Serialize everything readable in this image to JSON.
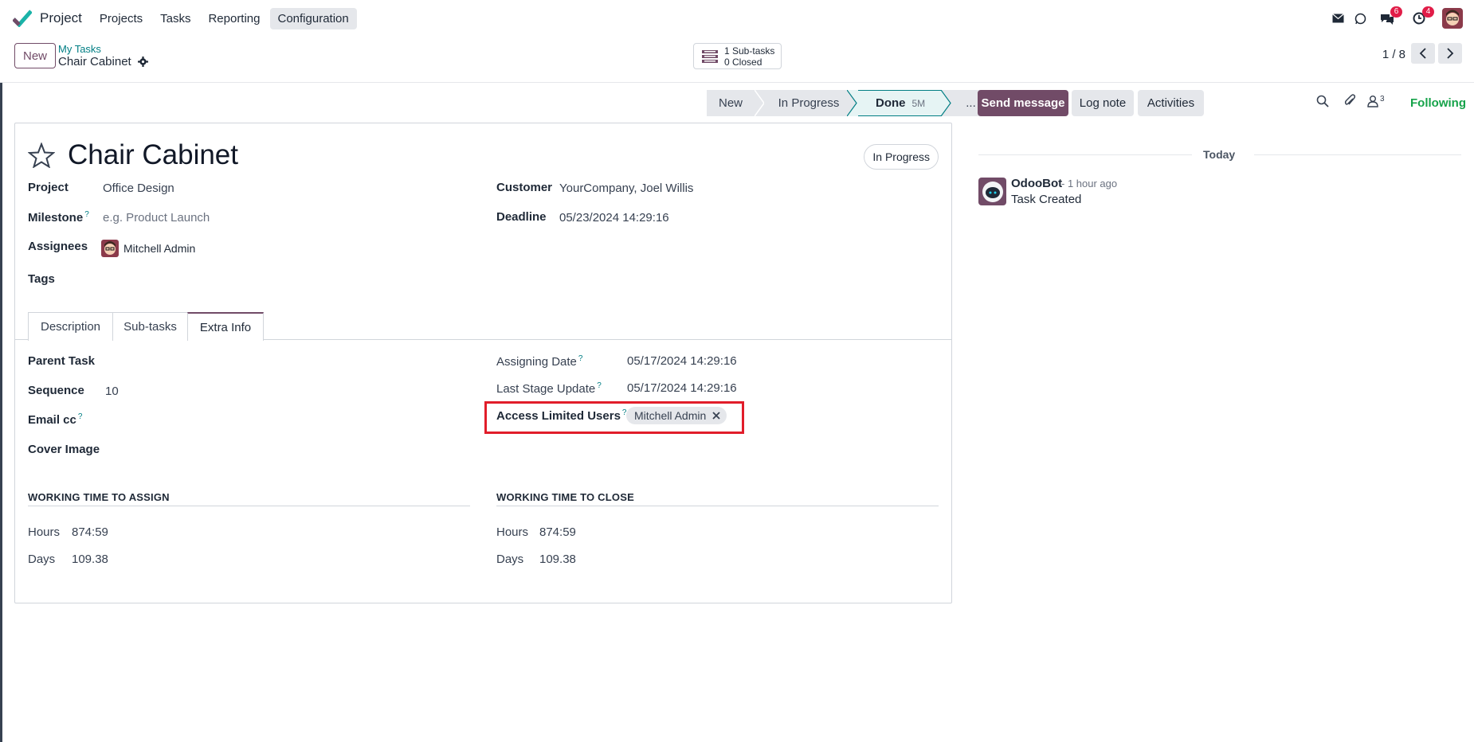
{
  "topnav": {
    "app_name": "Project",
    "menu": [
      "Projects",
      "Tasks",
      "Reporting",
      "Configuration"
    ],
    "active_menu": "Configuration",
    "badges": {
      "chat": "6",
      "activity": "4"
    },
    "icons": [
      "envelope-icon",
      "whatsapp-icon",
      "chat-icon",
      "clock-icon",
      "user-avatar"
    ]
  },
  "control": {
    "new_label": "New",
    "breadcrumb_parent": "My Tasks",
    "breadcrumb_current": "Chair Cabinet",
    "subtasks_line1": "1 Sub-tasks",
    "subtasks_line2": "0 Closed",
    "pager": "1 / 8"
  },
  "statusbar": {
    "stages": [
      "New",
      "In Progress",
      "Done",
      "..."
    ],
    "done_duration": "5M",
    "current": "Done"
  },
  "form": {
    "title": "Chair Cabinet",
    "state_pill": "In Progress",
    "project_label": "Project",
    "project_value": "Office Design",
    "milestone_label": "Milestone",
    "milestone_placeholder": "e.g. Product Launch",
    "assignees_label": "Assignees",
    "assignee_name": "Mitchell Admin",
    "tags_label": "Tags",
    "customer_label": "Customer",
    "customer_value": "YourCompany, Joel Willis",
    "deadline_label": "Deadline",
    "deadline_value": "05/23/2024 14:29:16",
    "tabs": [
      "Description",
      "Sub-tasks",
      "Extra Info"
    ],
    "active_tab": "Extra Info",
    "extra": {
      "parent_task_label": "Parent Task",
      "sequence_label": "Sequence",
      "sequence_value": "10",
      "email_cc_label": "Email cc",
      "cover_image_label": "Cover Image",
      "assigning_date_label": "Assigning Date",
      "assigning_date_value": "05/17/2024 14:29:16",
      "last_stage_label": "Last Stage Update",
      "last_stage_value": "05/17/2024 14:29:16",
      "access_label": "Access Limited Users",
      "access_user": "Mitchell Admin",
      "assign_section": "WORKING TIME TO ASSIGN",
      "close_section": "WORKING TIME TO CLOSE",
      "hours_label": "Hours",
      "days_label": "Days",
      "assign_hours": "874:59",
      "assign_days": "109.38",
      "close_hours": "874:59",
      "close_days": "109.38"
    }
  },
  "chatter": {
    "send_message": "Send message",
    "log_note": "Log note",
    "activities": "Activities",
    "followers_count": "3",
    "following": "Following",
    "today": "Today",
    "author": "OdooBot",
    "time": "- 1 hour ago",
    "message": "Task Created"
  },
  "colors": {
    "brand": "#714b67",
    "link": "#017e84",
    "highlight": "#e11d2a",
    "following": "#16a34a"
  }
}
